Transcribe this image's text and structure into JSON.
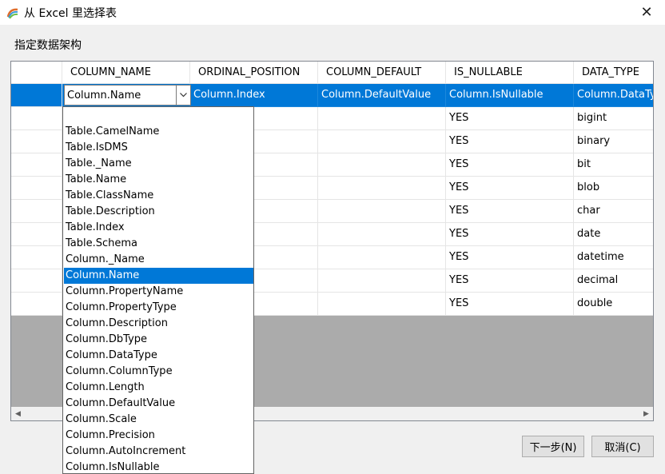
{
  "window": {
    "title": "从 Excel 里选择表",
    "close_glyph": "✕"
  },
  "section_title": "指定数据架构",
  "columns": [
    "COLUMN_NAME",
    "ORDINAL_POSITION",
    "COLUMN_DEFAULT",
    "IS_NULLABLE",
    "DATA_TYPE"
  ],
  "selected_row": [
    "Column.Name",
    "Column.Index",
    "Column.DefaultValue",
    "Column.IsNullable",
    "Column.DataType"
  ],
  "rows": [
    {
      "is_nullable": "YES",
      "data_type": "bigint"
    },
    {
      "is_nullable": "YES",
      "data_type": "binary"
    },
    {
      "is_nullable": "YES",
      "data_type": "bit"
    },
    {
      "is_nullable": "YES",
      "data_type": "blob"
    },
    {
      "is_nullable": "YES",
      "data_type": "char"
    },
    {
      "is_nullable": "YES",
      "data_type": "date"
    },
    {
      "is_nullable": "YES",
      "data_type": "datetime"
    },
    {
      "is_nullable": "YES",
      "data_type": "decimal"
    },
    {
      "is_nullable": "YES",
      "data_type": "double"
    }
  ],
  "combo": {
    "value": "Column.Name"
  },
  "dropdown": {
    "items": [
      "",
      "Table.CamelName",
      "Table.IsDMS",
      "Table._Name",
      "Table.Name",
      "Table.ClassName",
      "Table.Description",
      "Table.Index",
      "Table.Schema",
      "Column._Name",
      "Column.Name",
      "Column.PropertyName",
      "Column.PropertyType",
      "Column.Description",
      "Column.DbType",
      "Column.DataType",
      "Column.ColumnType",
      "Column.Length",
      "Column.DefaultValue",
      "Column.Scale",
      "Column.Precision",
      "Column.AutoIncrement",
      "Column.IsNullable"
    ],
    "selected_index": 10
  },
  "buttons": {
    "next": "下一步(N)",
    "cancel": "取消(C)"
  },
  "colors": {
    "selection": "#0078d7",
    "grid_bg": "#ababab"
  }
}
